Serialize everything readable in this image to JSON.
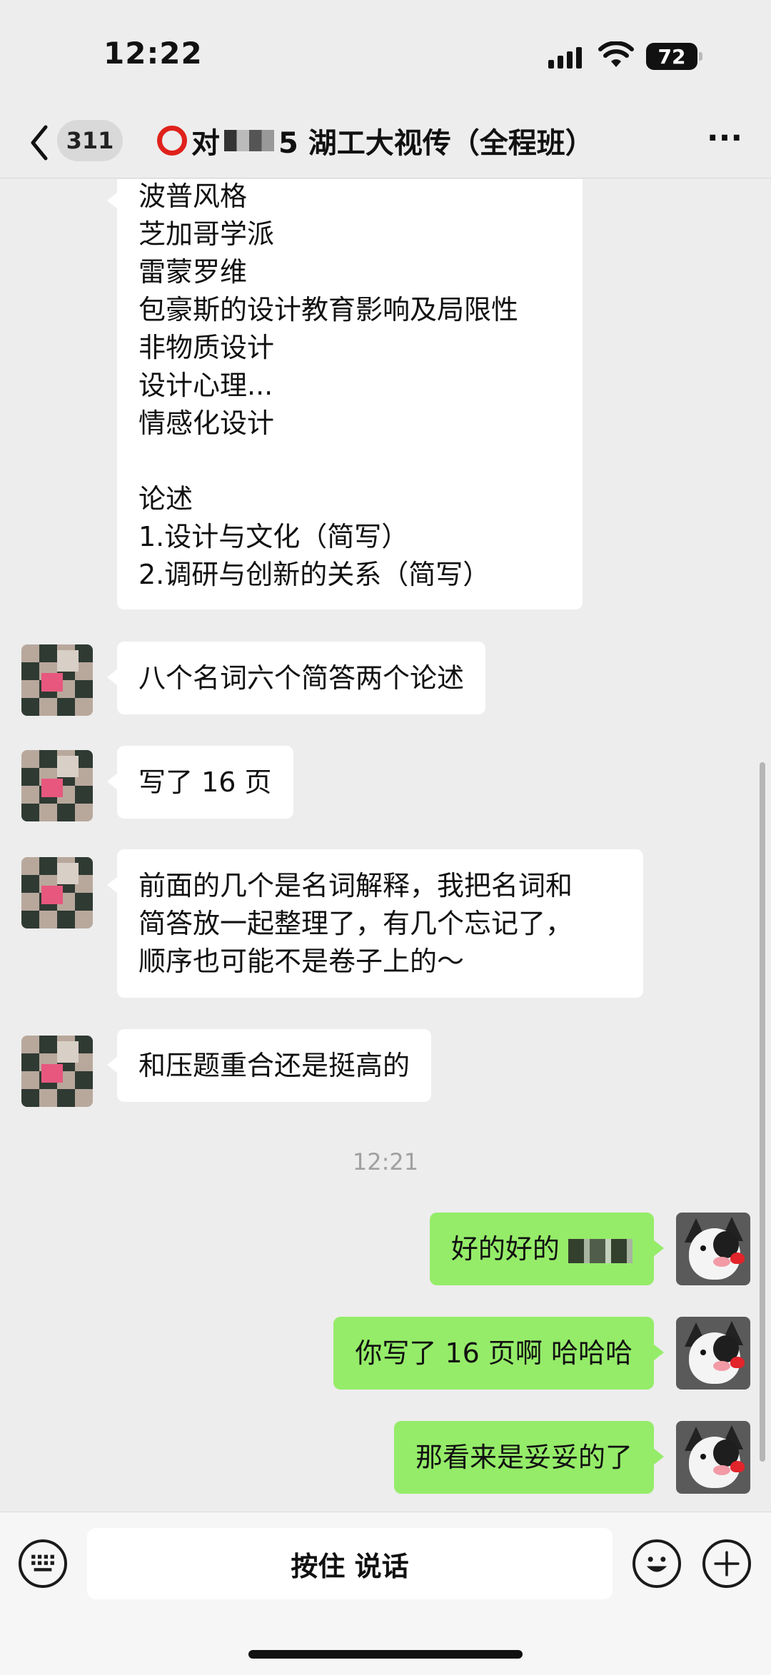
{
  "status_bar": {
    "time": "12:22",
    "battery": "72"
  },
  "nav": {
    "unread_count": "311",
    "title_prefix": "对",
    "title_main": "5 湖工大视传（全程班）",
    "more": "···"
  },
  "messages": {
    "long_list": [
      "波普风格",
      "芝加哥学派",
      "雷蒙罗维",
      "包豪斯的设计教育影响及局限性",
      "非物质设计",
      "设计心理...",
      "情感化设计",
      "",
      "论述",
      "1.设计与文化（简写）",
      "2.调研与创新的关系（简写）"
    ],
    "msg1": "八个名词六个简答两个论述",
    "msg2": "写了 16 页",
    "msg3": [
      "前面的几个是名词解释，我把名词和",
      "简答放一起整理了，有几个忘记了，",
      "顺序也可能不是卷子上的～"
    ],
    "msg4": "和压题重合还是挺高的",
    "timestamp": "12:21",
    "out1": "好的好的",
    "out2": "你写了 16 页啊 哈哈哈",
    "out3": "那看来是妥妥的了"
  },
  "input_bar": {
    "voice_label": "按住 说话"
  },
  "colors": {
    "outgoing_bubble": "#95ec69",
    "background": "#ededed",
    "circle_icon": "#e0211b"
  },
  "icons": [
    "back-chevron-icon",
    "more-icon",
    "keyboard-icon",
    "emoji-icon",
    "plus-icon",
    "wifi-icon",
    "signal-icon",
    "battery-icon"
  ]
}
